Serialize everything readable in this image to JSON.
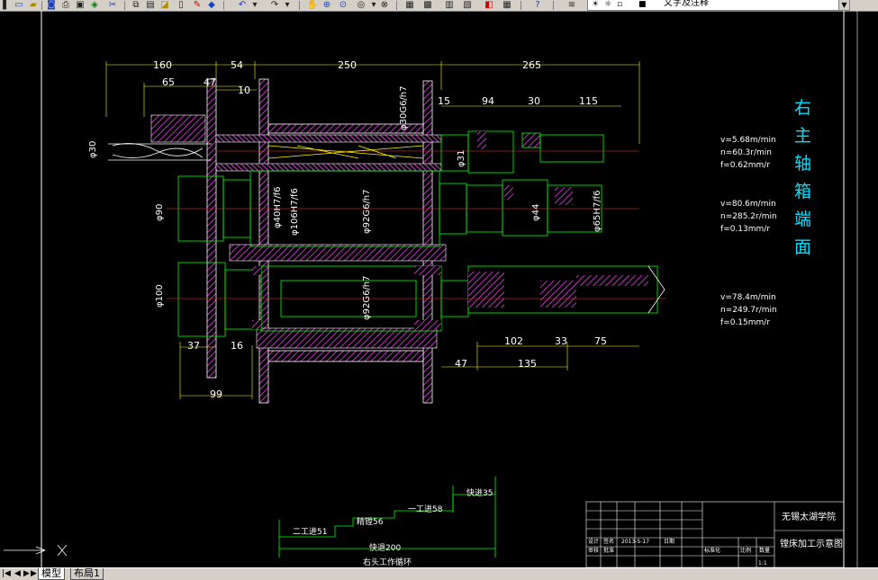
{
  "toolbar": {
    "layer_name": "文字及注释",
    "buttons": [
      "new-icon",
      "open-icon",
      "save-icon",
      "print-icon",
      "plot-preview-icon",
      "publish-icon",
      "cut-icon",
      "copy-icon",
      "paste-icon",
      "match-prop-icon",
      "undo-icon",
      "redo-icon",
      "pan-icon",
      "zoom-realtime-icon",
      "zoom-window-icon",
      "zoom-previous-icon",
      "properties-icon",
      "design-center-icon",
      "tool-palette-icon",
      "sheet-set-icon",
      "markup-icon",
      "calc-icon",
      "help-icon",
      "layer-manager-icon"
    ]
  },
  "drawing": {
    "title_vertical": [
      "右",
      "主",
      "轴",
      "箱",
      "端",
      "面"
    ],
    "dims_top": [
      "160",
      "54",
      "250",
      "265"
    ],
    "dims_second": [
      "65",
      "47",
      "10",
      "15",
      "94",
      "30",
      "115"
    ],
    "dims_bottom": [
      "37",
      "16",
      "99",
      "102",
      "33",
      "75",
      "47",
      "135"
    ],
    "dia_labels": {
      "d30g6": "φ30G6/h7",
      "d30": "φ30",
      "d31": "φ31",
      "d90": "φ90",
      "d40h7": "φ40H7/f6",
      "d106": "φ106H7/f6",
      "d92g6": "φ92G6/h7",
      "d44": "φ44",
      "d65": "φ65H7/f6",
      "d100": "φ100",
      "d92b": "φ92G6/h7"
    },
    "params": [
      {
        "v": "v=5.68m/min",
        "n": "n=60.3r/min",
        "f": "f=0.62mm/r"
      },
      {
        "v": "v=80.6m/min",
        "n": "n=285.2r/min",
        "f": "f=0.13mm/r"
      },
      {
        "v": "v=78.4m/min",
        "n": "n=249.7r/min",
        "f": "f=0.15mm/r"
      }
    ],
    "cycle": {
      "fast_in": "快进35",
      "work1": "一工进58",
      "work2": "二工进51",
      "work3": "精镗56",
      "fast_back": "快退200",
      "label": "右头工作循环"
    },
    "title_block": {
      "school": "无锡太湖学院",
      "drawing_name": "镗床加工示意图",
      "date": "2013-5-17",
      "row1": [
        "设计",
        "签名",
        "日期"
      ],
      "row2": [
        "审核",
        "批准"
      ],
      "row3": [
        "标准化",
        "比例",
        "数量"
      ],
      "scale": "1:1"
    }
  },
  "tabs": {
    "nav": [
      "|◀",
      "◀",
      "▶",
      "▶|"
    ],
    "model": "模型",
    "layout1": "布局1"
  }
}
